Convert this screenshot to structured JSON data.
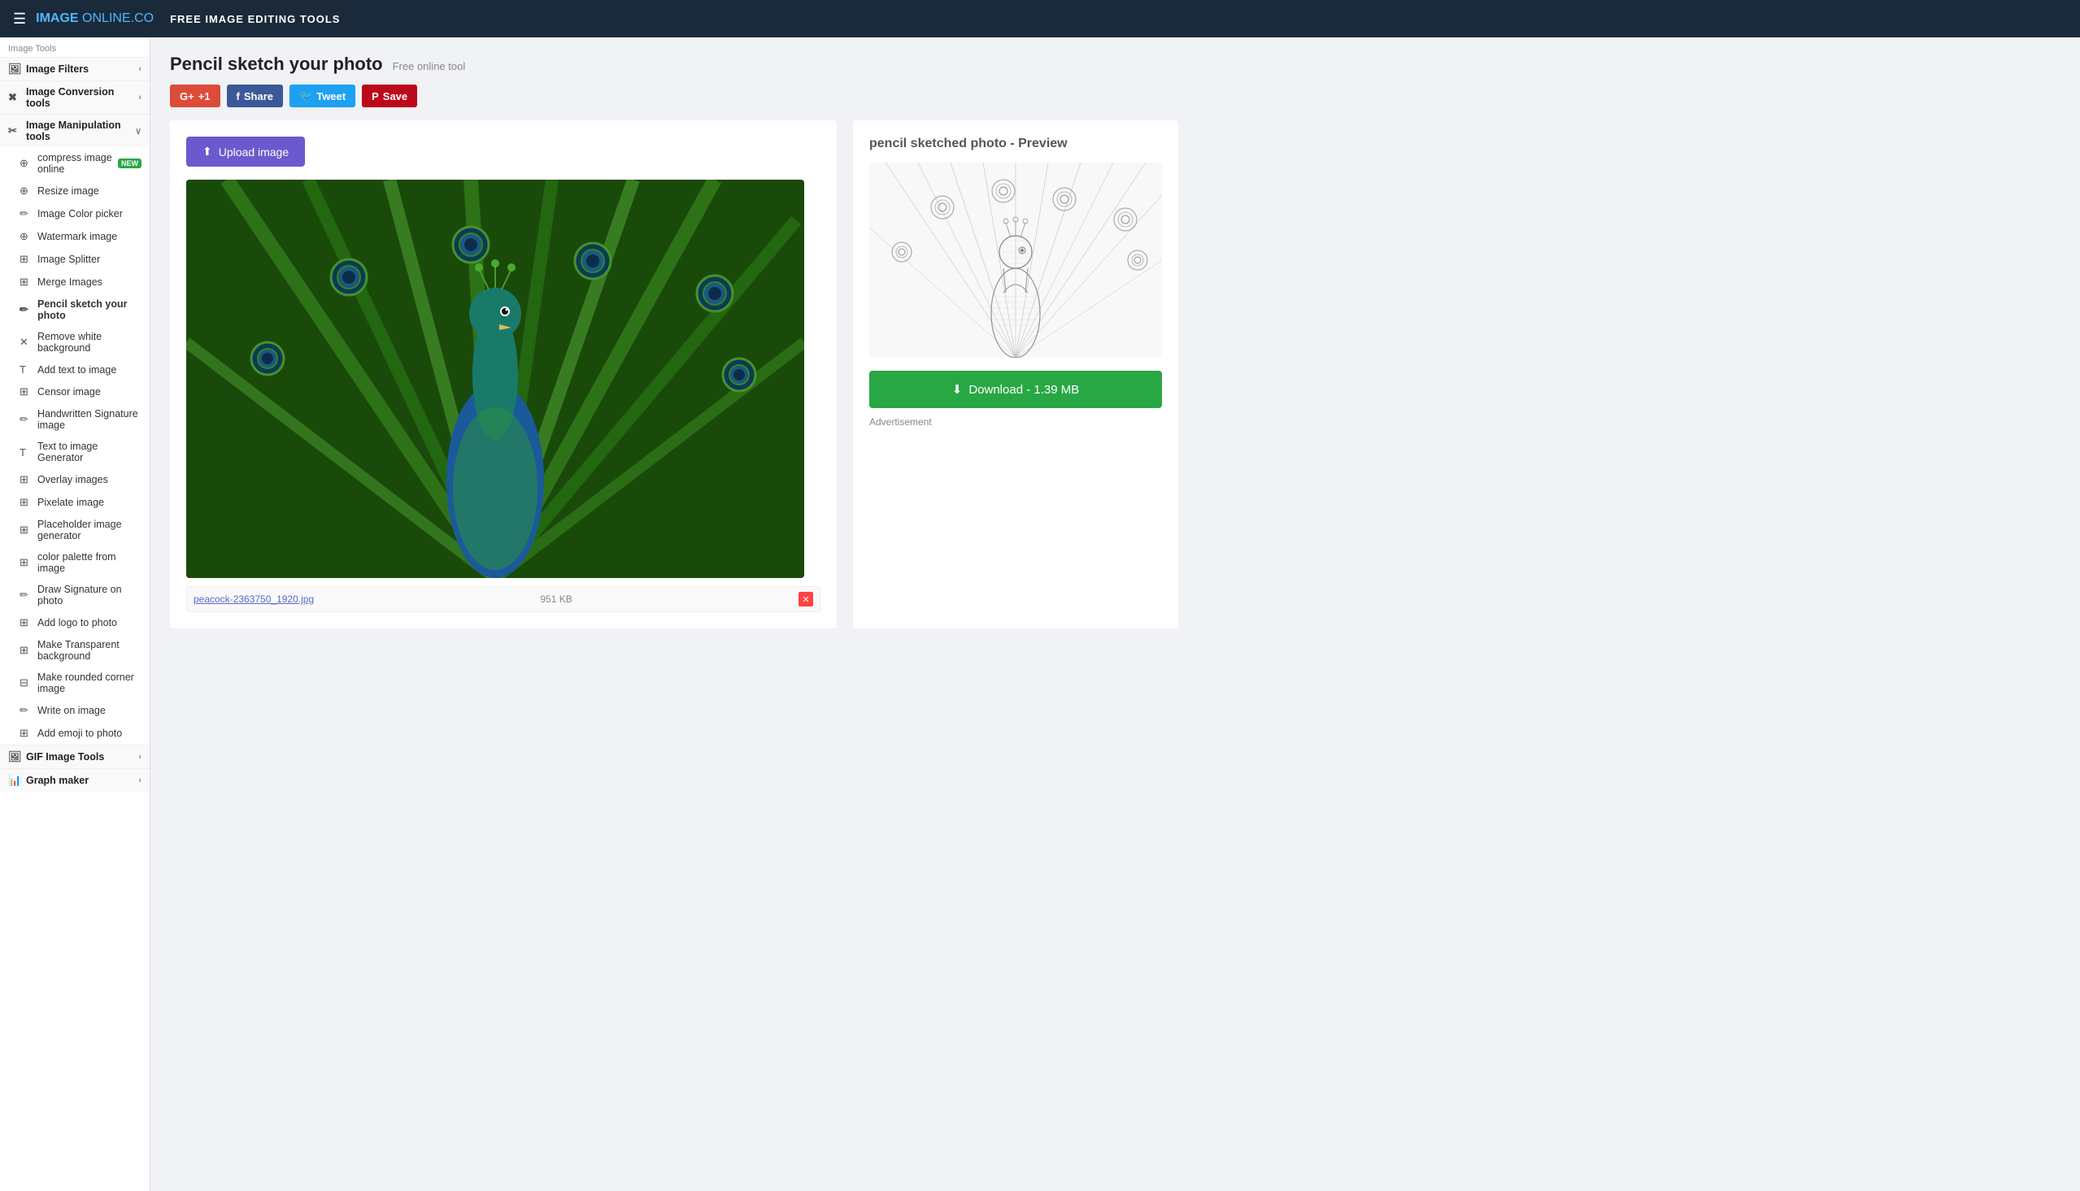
{
  "header": {
    "logo_text_image": "IMAGE",
    "logo_text_online": "ONLINE.CO",
    "menu_icon": "☰",
    "title": "FREE IMAGE EDITING TOOLS"
  },
  "sidebar": {
    "section_label": "Image Tools",
    "items": [
      {
        "id": "image-filters",
        "label": "Image Filters",
        "icon": "🖼",
        "has_chevron": true,
        "is_section": true
      },
      {
        "id": "image-conversion",
        "label": "Image Conversion tools",
        "icon": "🔄",
        "has_chevron": true,
        "is_section": true
      },
      {
        "id": "image-manipulation",
        "label": "Image Manipulation tools",
        "icon": "✂",
        "has_chevron": true,
        "is_section": true,
        "expanded": true
      },
      {
        "id": "compress-image",
        "label": "compress image online",
        "icon": "⊕",
        "badge": "NEW",
        "is_sub": true
      },
      {
        "id": "resize-image",
        "label": "Resize image",
        "icon": "⊕",
        "is_sub": true
      },
      {
        "id": "image-color-picker",
        "label": "Image Color picker",
        "icon": "✏",
        "is_sub": true
      },
      {
        "id": "watermark-image",
        "label": "Watermark image",
        "icon": "⊕",
        "is_sub": true
      },
      {
        "id": "image-splitter",
        "label": "Image Splitter",
        "icon": "⊞",
        "is_sub": true
      },
      {
        "id": "merge-images",
        "label": "Merge Images",
        "icon": "⊞",
        "is_sub": true
      },
      {
        "id": "pencil-sketch",
        "label": "Pencil sketch your photo",
        "icon": "✏",
        "is_sub": true,
        "active": true
      },
      {
        "id": "remove-white-bg",
        "label": "Remove white background",
        "icon": "✕",
        "is_sub": true
      },
      {
        "id": "add-text-to-image",
        "label": "Add text to image",
        "icon": "T",
        "is_sub": true
      },
      {
        "id": "censor-image",
        "label": "Censor image",
        "icon": "⊞",
        "is_sub": true
      },
      {
        "id": "handwritten-signature",
        "label": "Handwritten Signature image",
        "icon": "✏",
        "is_sub": true
      },
      {
        "id": "text-to-image",
        "label": "Text to image Generator",
        "icon": "T",
        "is_sub": true
      },
      {
        "id": "overlay-images",
        "label": "Overlay images",
        "icon": "⊞",
        "is_sub": true
      },
      {
        "id": "pixelate-image",
        "label": "Pixelate image",
        "icon": "⊞",
        "is_sub": true
      },
      {
        "id": "placeholder-image",
        "label": "Placeholder image generator",
        "icon": "⊞",
        "is_sub": true
      },
      {
        "id": "color-palette",
        "label": "color palette from image",
        "icon": "⊞",
        "is_sub": true
      },
      {
        "id": "draw-signature",
        "label": "Draw Signature on photo",
        "icon": "✏",
        "is_sub": true
      },
      {
        "id": "add-logo",
        "label": "Add logo to photo",
        "icon": "⊞",
        "is_sub": true
      },
      {
        "id": "make-transparent",
        "label": "Make Transparent background",
        "icon": "⊞",
        "is_sub": true
      },
      {
        "id": "rounded-corner",
        "label": "Make rounded corner image",
        "icon": "⊟",
        "is_sub": true
      },
      {
        "id": "write-on-image",
        "label": "Write on image",
        "icon": "✏",
        "is_sub": true
      },
      {
        "id": "add-emoji",
        "label": "Add emoji to photo",
        "icon": "⊞",
        "is_sub": true
      },
      {
        "id": "gif-image-tools",
        "label": "GIF Image Tools",
        "icon": "🖼",
        "has_chevron": true,
        "is_section": true
      },
      {
        "id": "graph-maker",
        "label": "Graph maker",
        "icon": "📊",
        "has_chevron": true,
        "is_section": true
      }
    ]
  },
  "page": {
    "title": "Pencil sketch your photo",
    "subtitle": "Free online tool",
    "share_buttons": [
      {
        "id": "gplus",
        "label": "+1",
        "prefix": "G+",
        "style": "gplus"
      },
      {
        "id": "facebook",
        "label": "Share",
        "style": "facebook"
      },
      {
        "id": "twitter",
        "label": "Tweet",
        "style": "twitter"
      },
      {
        "id": "pinterest",
        "label": "Save",
        "style": "pinterest"
      }
    ],
    "upload_button_label": "Upload image",
    "preview_title": "pencil sketched photo - Preview",
    "download_button_label": "Download - 1.39 MB",
    "advertisement_label": "Advertisement",
    "file_name": "peacock-2363750_1920.jpg",
    "file_size": "951 KB"
  }
}
